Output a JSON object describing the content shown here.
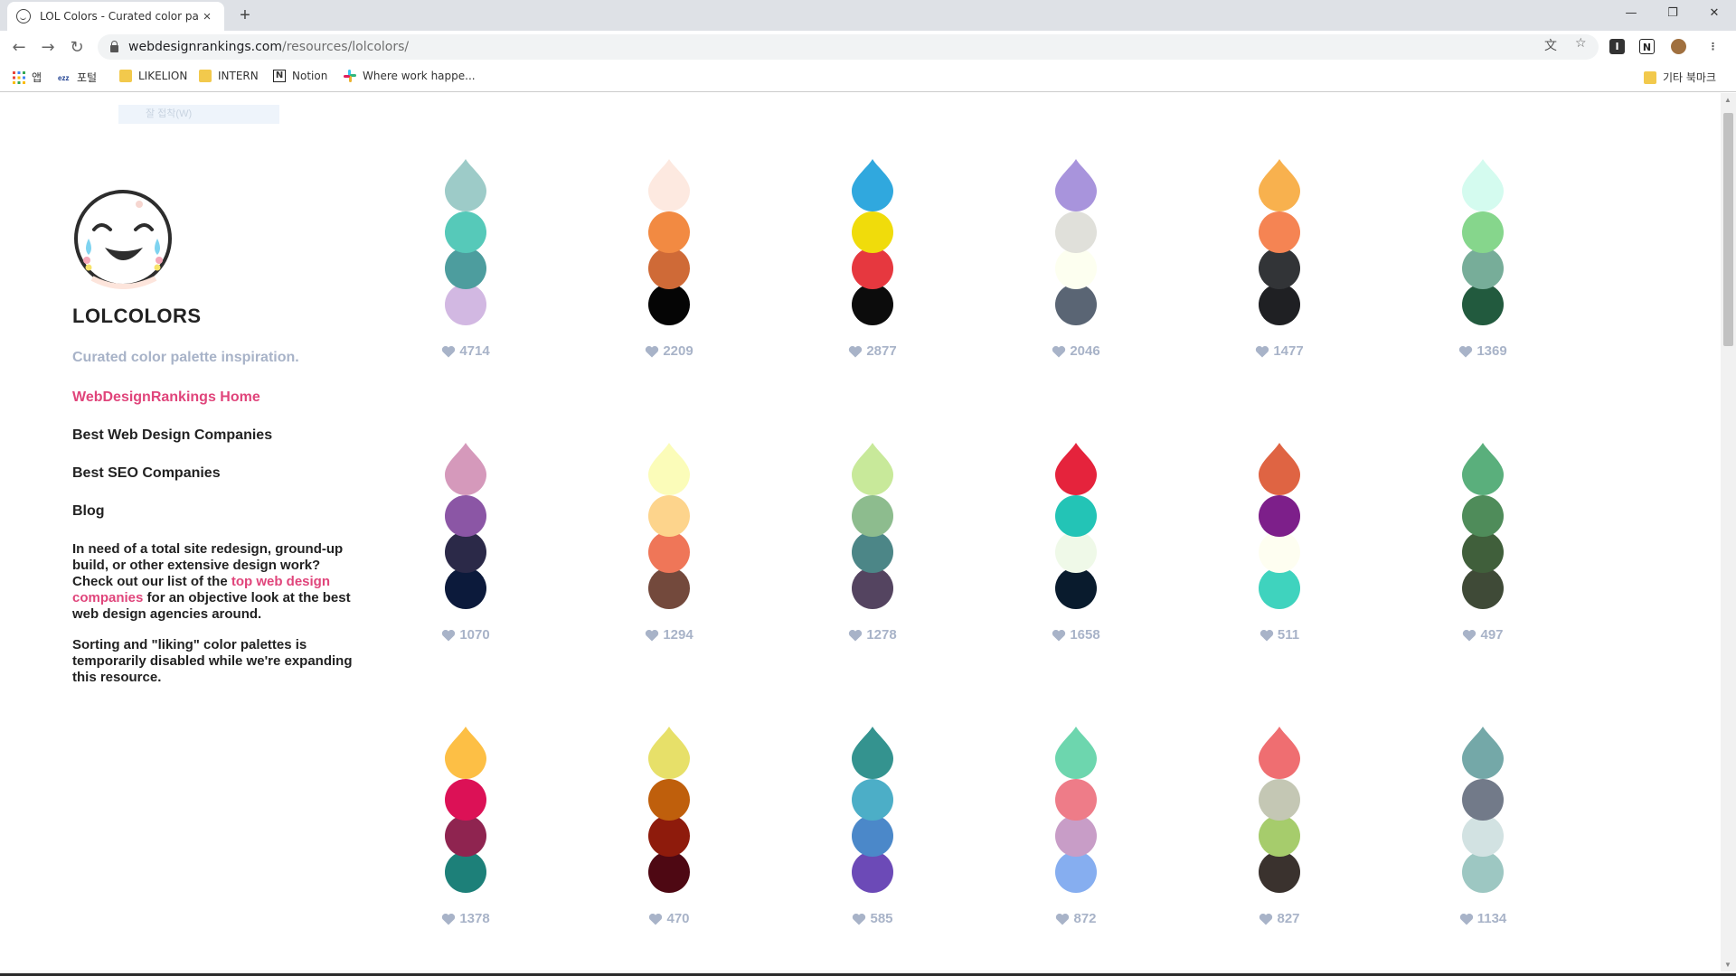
{
  "browser": {
    "tab_title": "LOL Colors - Curated color pale",
    "tab_close": "×",
    "new_tab": "+",
    "window_controls": [
      "—",
      "❐",
      "✕"
    ],
    "url_host": "webdesignrankings.com",
    "url_path": "/resources/lolcolors/",
    "bookmarks": [
      {
        "label": "앱",
        "icon": "apps-icon"
      },
      {
        "label": "포털",
        "icon": "portal-icon"
      },
      {
        "label": "LIKELION",
        "icon": "folder-icon"
      },
      {
        "label": "INTERN",
        "icon": "folder-icon"
      },
      {
        "label": "Notion",
        "icon": "notion-icon"
      },
      {
        "label": "Where work happe...",
        "icon": "slack-icon"
      }
    ],
    "other_bookmarks": "기타 북마크"
  },
  "page": {
    "ghost_bar": "잘 접착(W)",
    "brand": "LOLCOLORS",
    "tagline": "Curated color palette inspiration.",
    "nav": [
      {
        "label": "WebDesignRankings Home",
        "active": true
      },
      {
        "label": "Best Web Design Companies",
        "active": false
      },
      {
        "label": "Best SEO Companies",
        "active": false
      },
      {
        "label": "Blog",
        "active": false
      }
    ],
    "blurb1_pre": "In need of a total site redesign, ground-up build, or other extensive design work? Check out our list of the ",
    "blurb1_link": "top web design companies",
    "blurb1_post": " for an objective look at the best web design agencies around.",
    "blurb2": "Sorting and \"liking\" color palettes is temporarily disabled while we're expanding this resource."
  },
  "palettes": [
    {
      "colors": [
        "#9dcbc8",
        "#56c9b9",
        "#4d9d9e",
        "#d2b8e2"
      ],
      "likes": "4714"
    },
    {
      "colors": [
        "#fde9e0",
        "#f28a42",
        "#cf6a37",
        "#050505"
      ],
      "likes": "2209"
    },
    {
      "colors": [
        "#30a8de",
        "#f0dc0b",
        "#e6383f",
        "#0c0c0c"
      ],
      "likes": "2877"
    },
    {
      "colors": [
        "#a894dc",
        "#e0e0da",
        "#fdfff0",
        "#5a6574"
      ],
      "likes": "2046"
    },
    {
      "colors": [
        "#f8b14e",
        "#f58453",
        "#323437",
        "#1f2023"
      ],
      "likes": "1477"
    },
    {
      "colors": [
        "#d4fbef",
        "#86d68c",
        "#77ad99",
        "#225a3e"
      ],
      "likes": "1369"
    },
    {
      "colors": [
        "#d599bb",
        "#8b56a5",
        "#2b2948",
        "#0c1a3b"
      ],
      "likes": "1070"
    },
    {
      "colors": [
        "#fbfcb9",
        "#fdd48c",
        "#ef7658",
        "#73493c"
      ],
      "likes": "1294"
    },
    {
      "colors": [
        "#c8e99a",
        "#8dbc8e",
        "#4c8687",
        "#544460"
      ],
      "likes": "1278"
    },
    {
      "colors": [
        "#e5233c",
        "#23c4b6",
        "#eff9e8",
        "#091b2d"
      ],
      "likes": "1658"
    },
    {
      "colors": [
        "#df6443",
        "#7d1f8a",
        "#fefef1",
        "#3fd3be"
      ],
      "likes": "511"
    },
    {
      "colors": [
        "#5aaf7c",
        "#4f8c5a",
        "#405f3b",
        "#3f4a37"
      ],
      "likes": "497"
    },
    {
      "colors": [
        "#fdbf45",
        "#dc1156",
        "#8f2450",
        "#1d8079"
      ],
      "likes": "1378"
    },
    {
      "colors": [
        "#e7e069",
        "#bf5f0c",
        "#8e1b0c",
        "#4e0813"
      ],
      "likes": "470"
    },
    {
      "colors": [
        "#34938f",
        "#4caec7",
        "#4b88c9",
        "#6c4ab7"
      ],
      "likes": "585"
    },
    {
      "colors": [
        "#6dd6ae",
        "#ee7c88",
        "#c89dc7",
        "#86aef0"
      ],
      "likes": "872"
    },
    {
      "colors": [
        "#ef6e71",
        "#c4c7b4",
        "#a6cc6c",
        "#3a322e"
      ],
      "likes": "827"
    },
    {
      "colors": [
        "#74a8a8",
        "#727a89",
        "#d2e2e2",
        "#9dc7c2"
      ],
      "likes": "1134"
    }
  ]
}
